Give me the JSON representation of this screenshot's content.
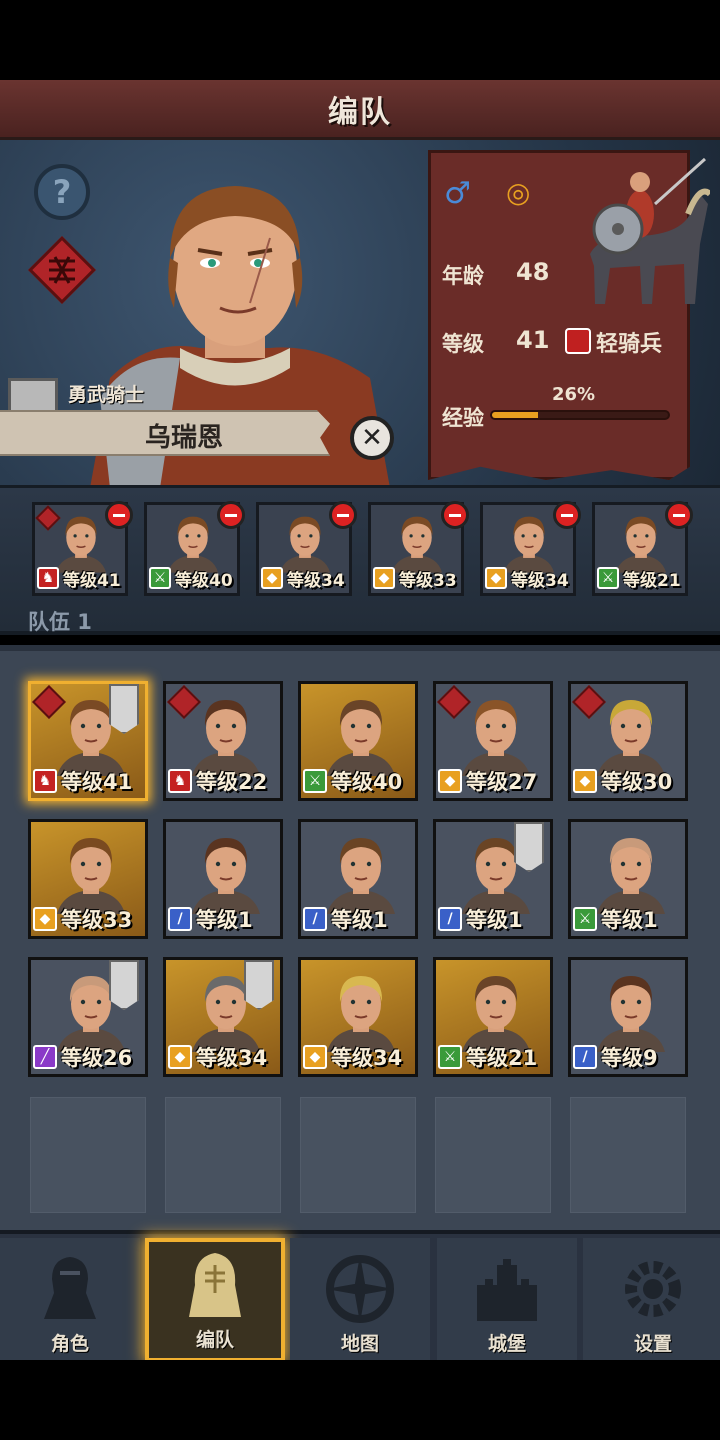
{
  "header": {
    "title": "编队"
  },
  "hero": {
    "title": "勇武骑士",
    "name": "乌瑞恩",
    "stats": {
      "age_label": "年龄",
      "age": "48",
      "level_label": "等级",
      "level": "41",
      "class": "轻骑兵",
      "exp_label": "经验",
      "exp_pct": "26%",
      "exp_fraction": 0.26
    }
  },
  "team": {
    "label": "队伍 1",
    "members": [
      {
        "level": "等级41",
        "type": "cavalry"
      },
      {
        "level": "等级40",
        "type": "archer"
      },
      {
        "level": "等级34",
        "type": "shield"
      },
      {
        "level": "等级33",
        "type": "shield"
      },
      {
        "level": "等级34",
        "type": "shield"
      },
      {
        "level": "等级21",
        "type": "archer"
      }
    ]
  },
  "roster": [
    {
      "level": "等级41",
      "type": "cavalry",
      "bg": "gold",
      "crest": true,
      "pennant": true,
      "selected": true,
      "hair": "#7a4a24"
    },
    {
      "level": "等级22",
      "type": "cavalry",
      "bg": "gray",
      "crest": true,
      "pennant": false,
      "selected": false,
      "hair": "#5a3420"
    },
    {
      "level": "等级40",
      "type": "archer",
      "bg": "gold",
      "crest": false,
      "pennant": false,
      "selected": false,
      "hair": "#6a4428"
    },
    {
      "level": "等级27",
      "type": "shield",
      "bg": "gray",
      "crest": true,
      "pennant": false,
      "selected": false,
      "hair": "#8a5428"
    },
    {
      "level": "等级30",
      "type": "shield",
      "bg": "gray",
      "crest": true,
      "pennant": false,
      "selected": false,
      "hair": "#c8a838"
    },
    {
      "level": "等级33",
      "type": "shield",
      "bg": "gold",
      "crest": false,
      "pennant": false,
      "selected": false,
      "hair": "#7a4a20"
    },
    {
      "level": "等级1",
      "type": "sword",
      "bg": "gray",
      "crest": false,
      "pennant": false,
      "selected": false,
      "hair": "#5a3420"
    },
    {
      "level": "等级1",
      "type": "sword",
      "bg": "gray",
      "crest": false,
      "pennant": false,
      "selected": false,
      "hair": "#6a4424"
    },
    {
      "level": "等级1",
      "type": "sword",
      "bg": "gray",
      "crest": false,
      "pennant": true,
      "selected": false,
      "hair": "#6a4424"
    },
    {
      "level": "等级1",
      "type": "archer",
      "bg": "gray",
      "crest": false,
      "pennant": false,
      "selected": false,
      "hair": "#c89a7a"
    },
    {
      "level": "等级26",
      "type": "mage",
      "bg": "gray",
      "crest": false,
      "pennant": true,
      "selected": false,
      "hair": "#c89a7a"
    },
    {
      "level": "等级34",
      "type": "shield",
      "bg": "gold",
      "crest": false,
      "pennant": true,
      "selected": false,
      "hair": "#6a6a6a"
    },
    {
      "level": "等级34",
      "type": "shield",
      "bg": "gold",
      "crest": false,
      "pennant": false,
      "selected": false,
      "hair": "#d8b850"
    },
    {
      "level": "等级21",
      "type": "archer",
      "bg": "gold",
      "crest": false,
      "pennant": false,
      "selected": false,
      "hair": "#6a4428"
    },
    {
      "level": "等级9",
      "type": "sword",
      "bg": "gray",
      "crest": false,
      "pennant": false,
      "selected": false,
      "hair": "#5a3420"
    }
  ],
  "nav": {
    "items": [
      {
        "label": "角色",
        "icon": "knight-icon",
        "active": false
      },
      {
        "label": "编队",
        "icon": "helmet-icon",
        "active": true
      },
      {
        "label": "地图",
        "icon": "compass-icon",
        "active": false
      },
      {
        "label": "城堡",
        "icon": "castle-icon",
        "active": false
      },
      {
        "label": "设置",
        "icon": "gear-icon",
        "active": false
      }
    ]
  },
  "colors": {
    "accent": "#f0b030",
    "cavalry": "#c42222",
    "archer": "#3a9a3a",
    "shield": "#e8a020",
    "sword": "#3a60c8",
    "mage": "#8a3ac8"
  }
}
